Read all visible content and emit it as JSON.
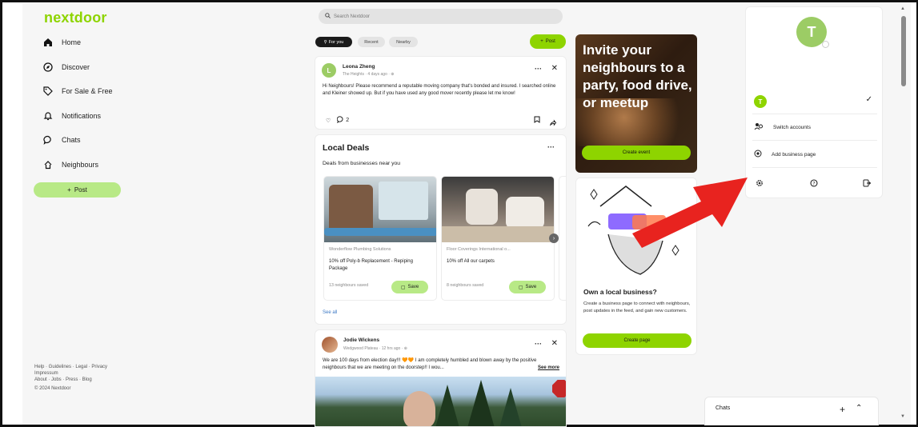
{
  "brand": {
    "logo": "nextdoor",
    "accent": "#8ed400"
  },
  "sidebar": {
    "items": [
      {
        "label": "Home",
        "icon": "home-icon"
      },
      {
        "label": "Discover",
        "icon": "compass-icon"
      },
      {
        "label": "For Sale & Free",
        "icon": "tag-icon"
      },
      {
        "label": "Notifications",
        "icon": "bell-icon"
      },
      {
        "label": "Chats",
        "icon": "chat-icon"
      },
      {
        "label": "Neighbours",
        "icon": "neighbours-icon"
      }
    ],
    "post_label": "Post",
    "footer": {
      "line1": "Help · Guidelines · Legal · Privacy",
      "line2": "Impressum",
      "line3": "About · Jobs · Press · Blog",
      "line4": "© 2024 Nextdoor"
    }
  },
  "search": {
    "placeholder": "Search Nextdoor"
  },
  "filters": {
    "for_you": "For you",
    "recent": "Recent",
    "nearby": "Nearby",
    "post": "Post"
  },
  "post1": {
    "author": "Leona Zheng",
    "avatar_letter": "L",
    "meta": "The Heights · 4 days ago · ⊕",
    "body": "Hi Neighbours! Please recommend a reputable moving company that's bonded and insured. I searched online and Kleiner showed up. But if you have used any good mover recently please let me know!",
    "comment_count": "2"
  },
  "deals": {
    "title": "Local Deals",
    "subtitle": "Deals from businesses near you",
    "see_all": "See all",
    "items": [
      {
        "business": "Wonderflow Plumbing Solutions",
        "offer": "10% off Poly-b Replacement - Repiping Package",
        "saved": "13 neighbours saved",
        "save": "Save"
      },
      {
        "business": "Floor Coverings International o...",
        "offer": "10% off All our carpets",
        "saved": "8 neighbours saved",
        "save": "Save"
      }
    ]
  },
  "post2": {
    "author": "Jodie Wickens",
    "meta": "Wedgwood Plateau · 12 hrs ago · ⊕",
    "body": "We are 100 days from election day!!! 🧡🧡 I am completely humbled and blown away by the positive neighbours that we are meeting on the doorstep!! I wou...",
    "see_more": "See more"
  },
  "invite": {
    "text": "Invite your neighbours to a party, food drive, or meetup",
    "button": "Create event"
  },
  "business_ad": {
    "title": "Own a local business?",
    "body": "Create a business page to connect with neighbours, post updates in the feed, and gain new customers.",
    "button": "Create page"
  },
  "account": {
    "avatar_letter": "T",
    "switch_accounts": "Switch accounts",
    "add_business_page": "Add business page"
  },
  "chats_bar": {
    "label": "Chats"
  }
}
